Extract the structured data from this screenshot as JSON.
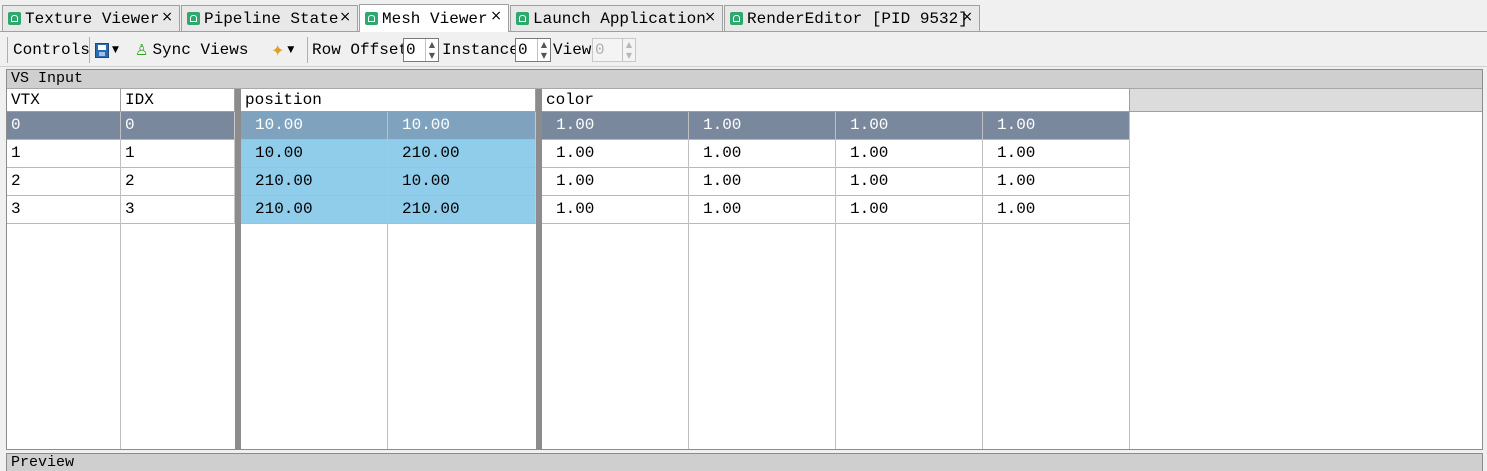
{
  "tabs": [
    {
      "label": "Texture Viewer",
      "close": "×"
    },
    {
      "label": "Pipeline State",
      "close": "×"
    },
    {
      "label": "Mesh Viewer",
      "close": "×"
    },
    {
      "label": "Launch Application",
      "close": "×"
    },
    {
      "label": "RenderEditor [PID 9532]",
      "close": "×"
    }
  ],
  "toolbar": {
    "controls_label": "Controls",
    "sync_views_label": "Sync Views",
    "row_offset_label": "Row Offset",
    "row_offset_value": "0",
    "instance_label": "Instance",
    "instance_value": "0",
    "view_label": "View",
    "view_value": "0"
  },
  "vs_input": {
    "title": "VS Input",
    "headers": {
      "vtx": "VTX",
      "idx": "IDX",
      "position": "position",
      "color": "color"
    },
    "rows": [
      {
        "vtx": "0",
        "idx": "0",
        "pos": [
          "10.00",
          "10.00"
        ],
        "color": [
          "1.00",
          "1.00",
          "1.00",
          "1.00"
        ]
      },
      {
        "vtx": "1",
        "idx": "1",
        "pos": [
          "10.00",
          "210.00"
        ],
        "color": [
          "1.00",
          "1.00",
          "1.00",
          "1.00"
        ]
      },
      {
        "vtx": "2",
        "idx": "2",
        "pos": [
          "210.00",
          "10.00"
        ],
        "color": [
          "1.00",
          "1.00",
          "1.00",
          "1.00"
        ]
      },
      {
        "vtx": "3",
        "idx": "3",
        "pos": [
          "210.00",
          "210.00"
        ],
        "color": [
          "1.00",
          "1.00",
          "1.00",
          "1.00"
        ]
      }
    ],
    "selected_row": 0
  },
  "preview": {
    "title": "Preview"
  },
  "colors": {
    "position_highlight": "#8fcdea",
    "selected_row": "#7a889e",
    "tab_icon": "#2fa86e"
  }
}
